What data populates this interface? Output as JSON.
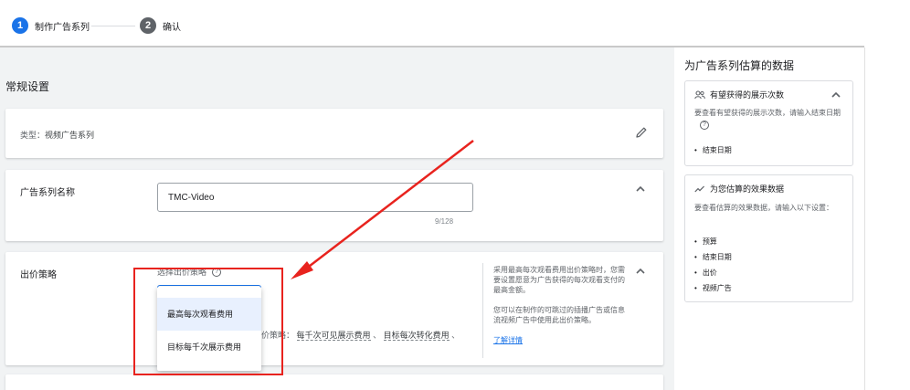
{
  "stepper": {
    "steps": [
      {
        "number": "1",
        "label": "制作广告系列"
      },
      {
        "number": "2",
        "label": "确认"
      }
    ]
  },
  "main": {
    "section_title": "常规设置",
    "type_card": {
      "prefix": "类型：",
      "value": "视频广告系列"
    },
    "name_card": {
      "label": "广告系列名称",
      "value": "TMC-Video",
      "count": "9/128"
    },
    "bid_card": {
      "label": "出价策略",
      "prompt": "选择出价策略",
      "other_prefix": "价策略：",
      "other_links": [
        "每千次可见展示费用",
        "目标每次转化费用"
      ],
      "separator": "、",
      "help_p1": "采用最高每次观看费用出价策略时，您需要设置愿意为广告获得的每次观看支付的最高金额。",
      "help_p2": "您可以在制作的可跳过的插播广告或信息流视频广告中使用此出价策略。",
      "learn_more": "了解详情"
    },
    "dropdown": {
      "options": [
        "最高每次观看费用",
        "目标每千次展示费用"
      ],
      "selected_index": 0
    }
  },
  "side": {
    "title": "为广告系列估算的数据",
    "card1": {
      "title": "有望获得的展示次数",
      "desc": "要查看有望获得的展示次数，请输入结束日期",
      "items": [
        "结束日期"
      ]
    },
    "card2": {
      "title": "为您估算的效果数据",
      "desc": "要查看估算的效果数据，请输入以下设置：",
      "items": [
        "预算",
        "结束日期",
        "出价",
        "视频广告"
      ]
    }
  },
  "colors": {
    "accent": "#1a73e8",
    "annotation": "#e8231e"
  }
}
